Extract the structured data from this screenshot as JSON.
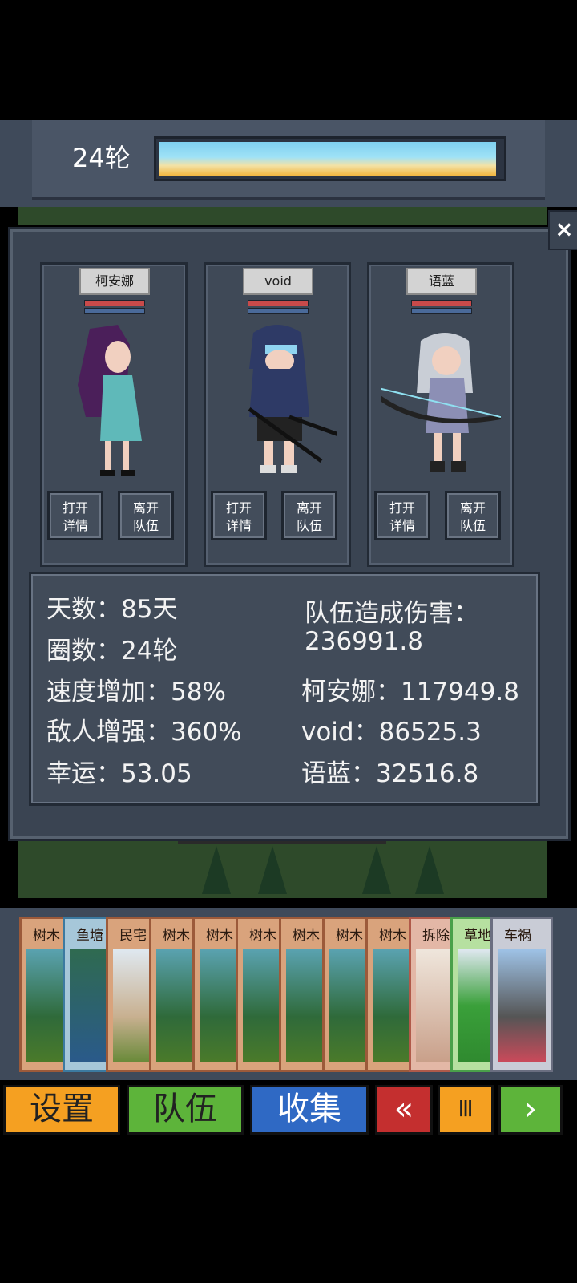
{
  "header": {
    "round_label": "24轮",
    "progress": 0.99
  },
  "close_icon": "×",
  "party": [
    {
      "name": "柯安娜",
      "details_label": [
        "打开",
        "详情"
      ],
      "leave_label": [
        "离开",
        "队伍"
      ]
    },
    {
      "name": "void",
      "details_label": [
        "打开",
        "详情"
      ],
      "leave_label": [
        "离开",
        "队伍"
      ]
    },
    {
      "name": "语蓝",
      "details_label": [
        "打开",
        "详情"
      ],
      "leave_label": [
        "离开",
        "队伍"
      ]
    }
  ],
  "stats": {
    "days": "天数：85天",
    "laps": "圈数：24轮",
    "speed": "速度增加：58%",
    "enemy": "敌人增强：360%",
    "luck": "幸运：53.05",
    "team_damage_label": "队伍造成伤害：",
    "team_damage_value": "236991.8",
    "member1": "柯安娜：117949.8",
    "member2": "void：86525.3",
    "member3": "语蓝：32516.8"
  },
  "cards": [
    "树木",
    "鱼塘",
    "民宅",
    "树木",
    "树木",
    "树木",
    "树木",
    "树木",
    "树木",
    "拆除",
    "草地",
    "车祸"
  ],
  "bottom": {
    "settings": "设置",
    "team": "队伍",
    "collect": "收集",
    "rewind": "«",
    "pause": "Ⅲ",
    "forward": "›"
  },
  "colors": {
    "settings": "#f5a021",
    "team": "#5db43a",
    "collect": "#2f69c4",
    "rewind": "#c42f2f",
    "pause": "#f5a021",
    "forward": "#5db43a"
  }
}
